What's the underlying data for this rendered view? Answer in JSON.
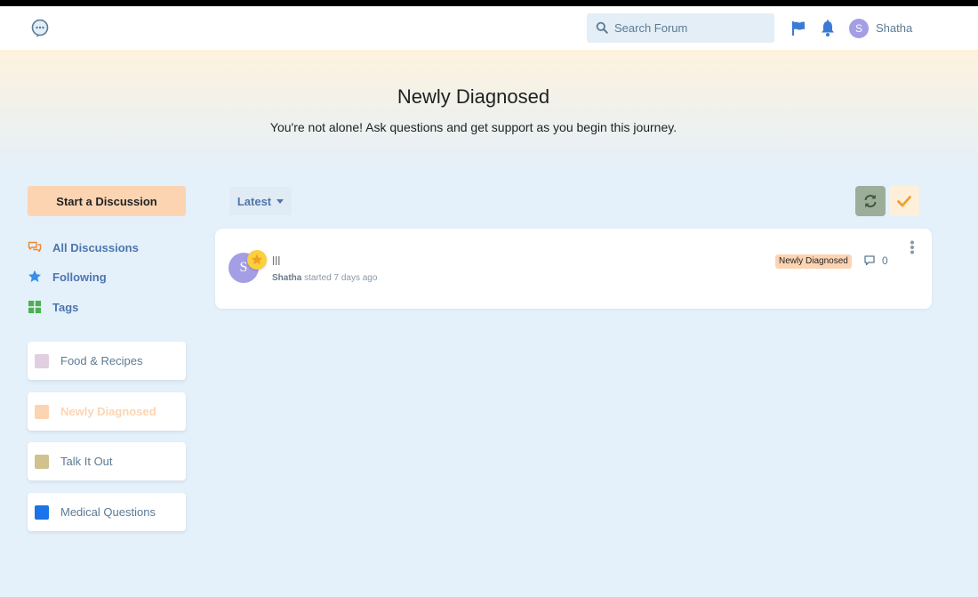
{
  "header": {
    "logo_icon": "chat-bubble-icon",
    "search_placeholder": "Search Forum",
    "user": {
      "initial": "S",
      "name": "Shatha"
    }
  },
  "hero": {
    "title": "Newly Diagnosed",
    "subtitle": "You're not alone! Ask questions and get support as you begin this journey."
  },
  "sidebar": {
    "start_label": "Start a Discussion",
    "nav": [
      {
        "label": "All Discussions",
        "icon": "comments-icon"
      },
      {
        "label": "Following",
        "icon": "star-icon"
      },
      {
        "label": "Tags",
        "icon": "grid-icon"
      }
    ],
    "tags": [
      {
        "label": "Food & Recipes",
        "color": "#e0cfe0"
      },
      {
        "label": "Newly Diagnosed",
        "color": "#fdd4b2"
      },
      {
        "label": "Talk It Out",
        "color": "#d1c18f"
      },
      {
        "label": "Medical Questions",
        "color": "#1a73e8"
      }
    ]
  },
  "toolbar": {
    "sort_label": "Latest"
  },
  "discussions": [
    {
      "avatar_initial": "S",
      "title": "lll",
      "author": "Shatha",
      "meta": "started 7 days ago",
      "tag": "Newly Diagnosed",
      "replies": "0"
    }
  ],
  "colors": {
    "accent": "#4d76ad",
    "start_button": "#fdd4b2",
    "avatar": "#a49ee4",
    "refresh_button": "#9cae9a",
    "mark_read_button": "#fdefd9"
  }
}
